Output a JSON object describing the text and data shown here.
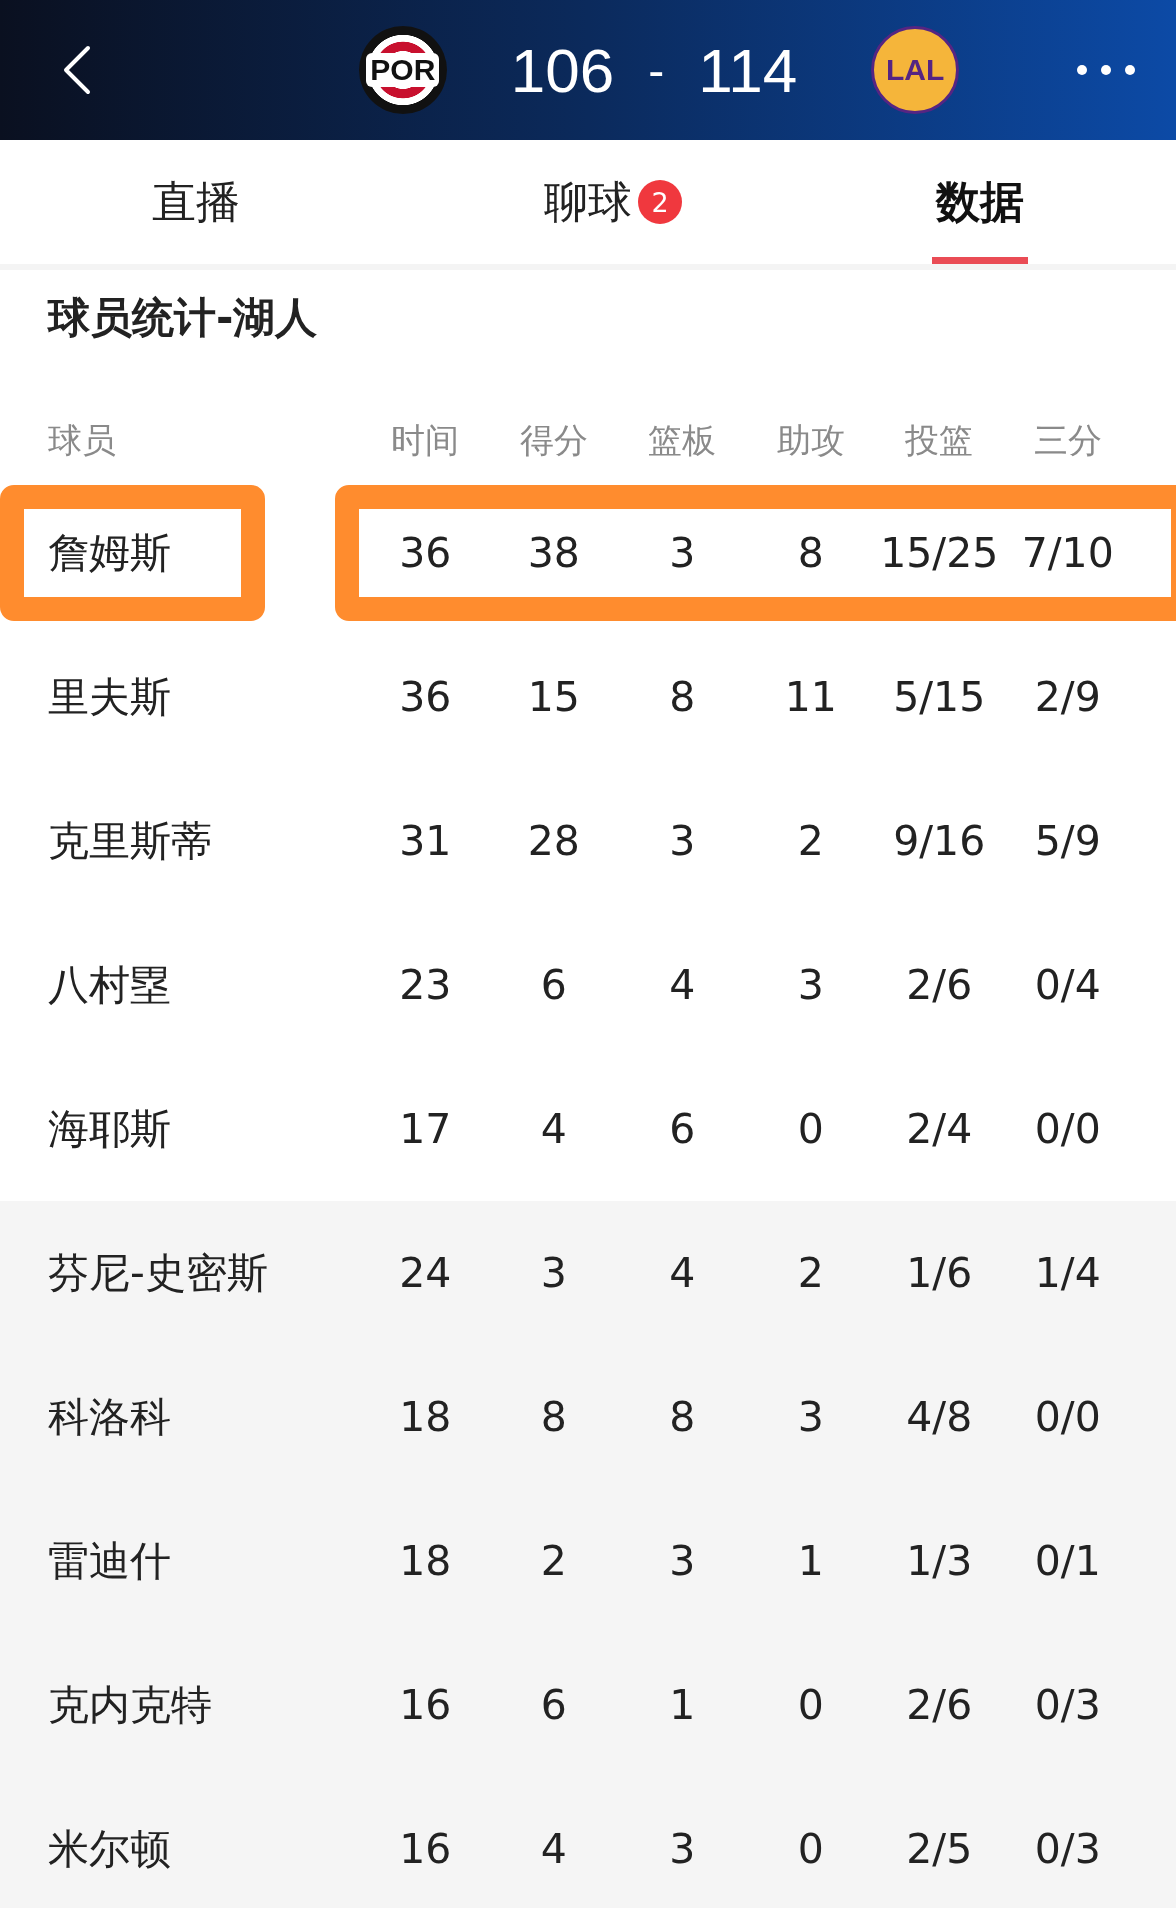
{
  "header": {
    "home_team": "POR",
    "score_home": "106",
    "separator": "-",
    "score_away": "114",
    "away_team": "LAL"
  },
  "tabs": [
    {
      "label": "直播",
      "selected": false
    },
    {
      "label": "聊球",
      "selected": false,
      "badge": "2"
    },
    {
      "label": "数据",
      "selected": true
    }
  ],
  "section_title": "球员统计-湖人",
  "table": {
    "columns": [
      "球员",
      "时间",
      "得分",
      "篮板",
      "助攻",
      "投篮",
      "三分"
    ],
    "rows": [
      {
        "cells": [
          "詹姆斯",
          "36",
          "38",
          "3",
          "8",
          "15/25",
          "7/10"
        ],
        "bench": false,
        "highlighted": true
      },
      {
        "cells": [
          "里夫斯",
          "36",
          "15",
          "8",
          "11",
          "5/15",
          "2/9"
        ],
        "bench": false,
        "highlighted": false
      },
      {
        "cells": [
          "克里斯蒂",
          "31",
          "28",
          "3",
          "2",
          "9/16",
          "5/9"
        ],
        "bench": false,
        "highlighted": false
      },
      {
        "cells": [
          "八村塁",
          "23",
          "6",
          "4",
          "3",
          "2/6",
          "0/4"
        ],
        "bench": false,
        "highlighted": false
      },
      {
        "cells": [
          "海耶斯",
          "17",
          "4",
          "6",
          "0",
          "2/4",
          "0/0"
        ],
        "bench": false,
        "highlighted": false
      },
      {
        "cells": [
          "芬尼-史密斯",
          "24",
          "3",
          "4",
          "2",
          "1/6",
          "1/4"
        ],
        "bench": true,
        "highlighted": false
      },
      {
        "cells": [
          "科洛科",
          "18",
          "8",
          "8",
          "3",
          "4/8",
          "0/0"
        ],
        "bench": true,
        "highlighted": false
      },
      {
        "cells": [
          "雷迪什",
          "18",
          "2",
          "3",
          "1",
          "1/3",
          "0/1"
        ],
        "bench": true,
        "highlighted": false
      },
      {
        "cells": [
          "克内克特",
          "16",
          "6",
          "1",
          "0",
          "2/6",
          "0/3"
        ],
        "bench": true,
        "highlighted": false
      },
      {
        "cells": [
          "米尔顿",
          "16",
          "4",
          "3",
          "0",
          "2/5",
          "0/3"
        ],
        "bench": true,
        "highlighted": false
      }
    ]
  }
}
